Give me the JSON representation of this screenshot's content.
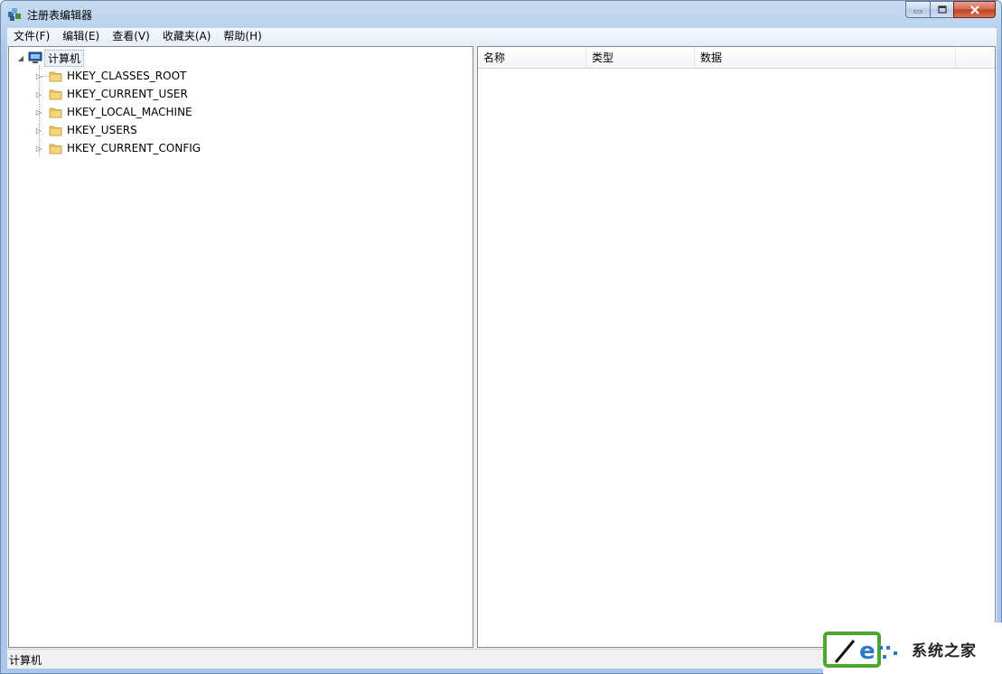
{
  "window": {
    "title": "注册表编辑器"
  },
  "menu": [
    {
      "label": "文件(F)"
    },
    {
      "label": "编辑(E)"
    },
    {
      "label": "查看(V)"
    },
    {
      "label": "收藏夹(A)"
    },
    {
      "label": "帮助(H)"
    }
  ],
  "tree": {
    "root": "计算机",
    "keys": [
      {
        "label": "HKEY_CLASSES_ROOT"
      },
      {
        "label": "HKEY_CURRENT_USER"
      },
      {
        "label": "HKEY_LOCAL_MACHINE"
      },
      {
        "label": "HKEY_USERS"
      },
      {
        "label": "HKEY_CURRENT_CONFIG"
      }
    ]
  },
  "list": {
    "columns": [
      {
        "label": "名称"
      },
      {
        "label": "类型"
      },
      {
        "label": "数据"
      }
    ]
  },
  "status": {
    "path": "计算机"
  },
  "watermark": {
    "text": "系统之家"
  },
  "colors": {
    "title_gradient": "#bad2ee",
    "close_button": "#c2401e",
    "folder": "#e8c260"
  }
}
